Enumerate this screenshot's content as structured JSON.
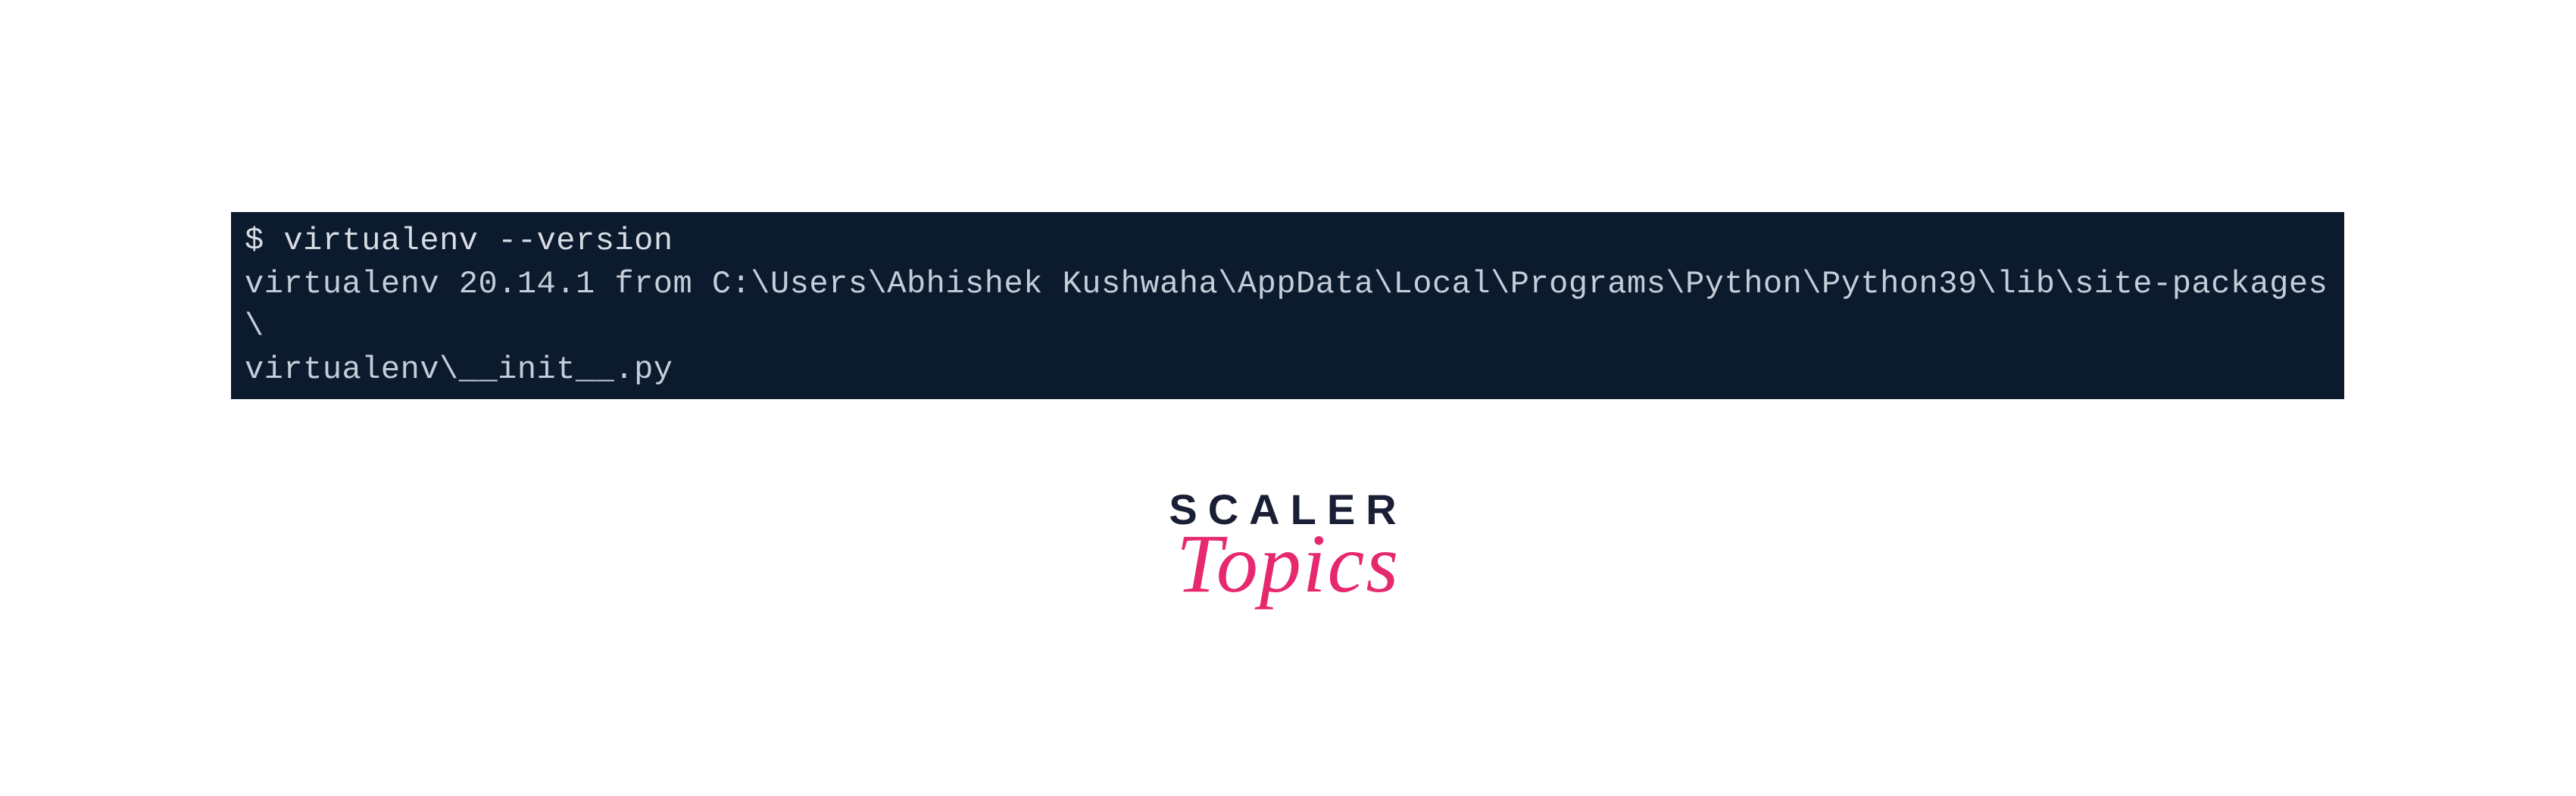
{
  "terminal": {
    "prompt": "$",
    "command": "virtualenv --version",
    "output_line1": "virtualenv 20.14.1 from C:\\Users\\Abhishek Kushwaha\\AppData\\Local\\Programs\\Python\\Python39\\lib\\site-packages\\",
    "output_line2": "virtualenv\\__init__.py"
  },
  "logo": {
    "line1": "SCALER",
    "line2": "Topics"
  }
}
